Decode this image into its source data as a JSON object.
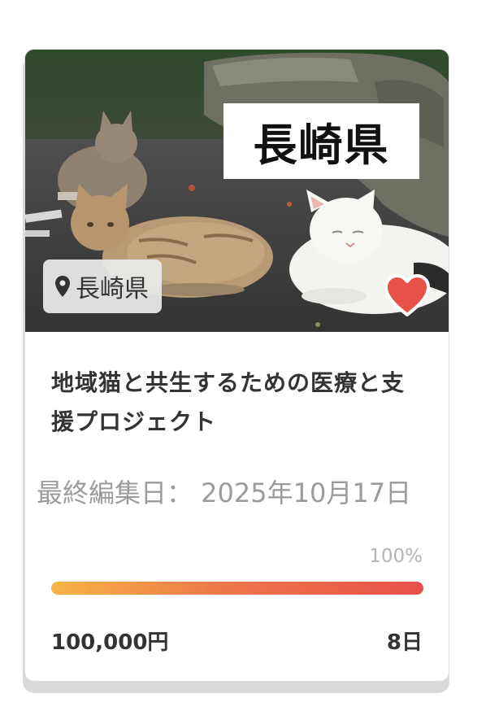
{
  "card": {
    "image_sign_text": "長崎県",
    "location_label": "長崎県",
    "location_icon": "map-pin-icon",
    "favorite_icon": "heart-icon",
    "favorite_color": "#e8504a",
    "title": "地域猫と共生するための医療と支援プロジェクト",
    "edit_date": "最終編集日： 2025年10月17日",
    "progress_percent_label": "100%",
    "progress_fraction": 1.0,
    "amount": "100,000円",
    "days_left": "8日"
  },
  "colors": {
    "progress_start": "#f6b445",
    "progress_end": "#e8504a",
    "text_dark": "#333333",
    "text_muted": "#9b9b9b"
  }
}
